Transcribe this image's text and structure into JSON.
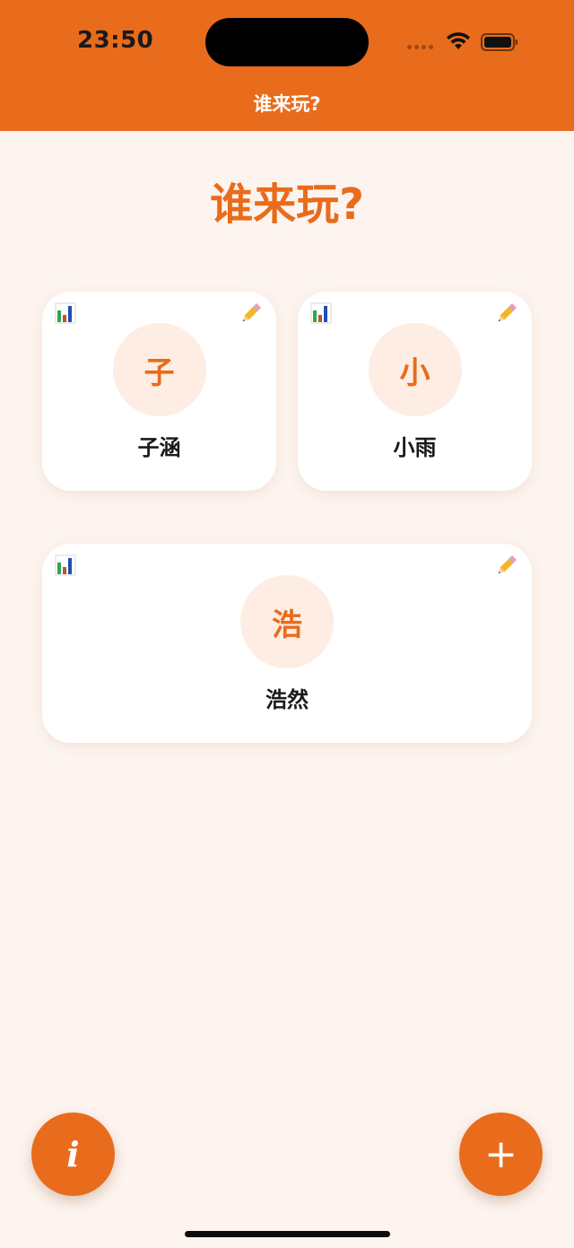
{
  "status_bar": {
    "time": "23:50"
  },
  "nav": {
    "title": "谁来玩?"
  },
  "page": {
    "title": "谁来玩?"
  },
  "players": [
    {
      "avatar_char": "子",
      "name": "子涵"
    },
    {
      "avatar_char": "小",
      "name": "小雨"
    },
    {
      "avatar_char": "浩",
      "name": "浩然"
    }
  ],
  "icons": {
    "stats": "bar-chart-icon",
    "edit": "pencil-icon",
    "info": "info-icon",
    "add": "plus-icon"
  },
  "fab": {
    "info_label": "i",
    "add_label": "+"
  },
  "colors": {
    "accent": "#E86C1C",
    "background": "#FDF4EF",
    "card": "#FFFFFF",
    "avatar_bg": "#FDEDE2"
  }
}
